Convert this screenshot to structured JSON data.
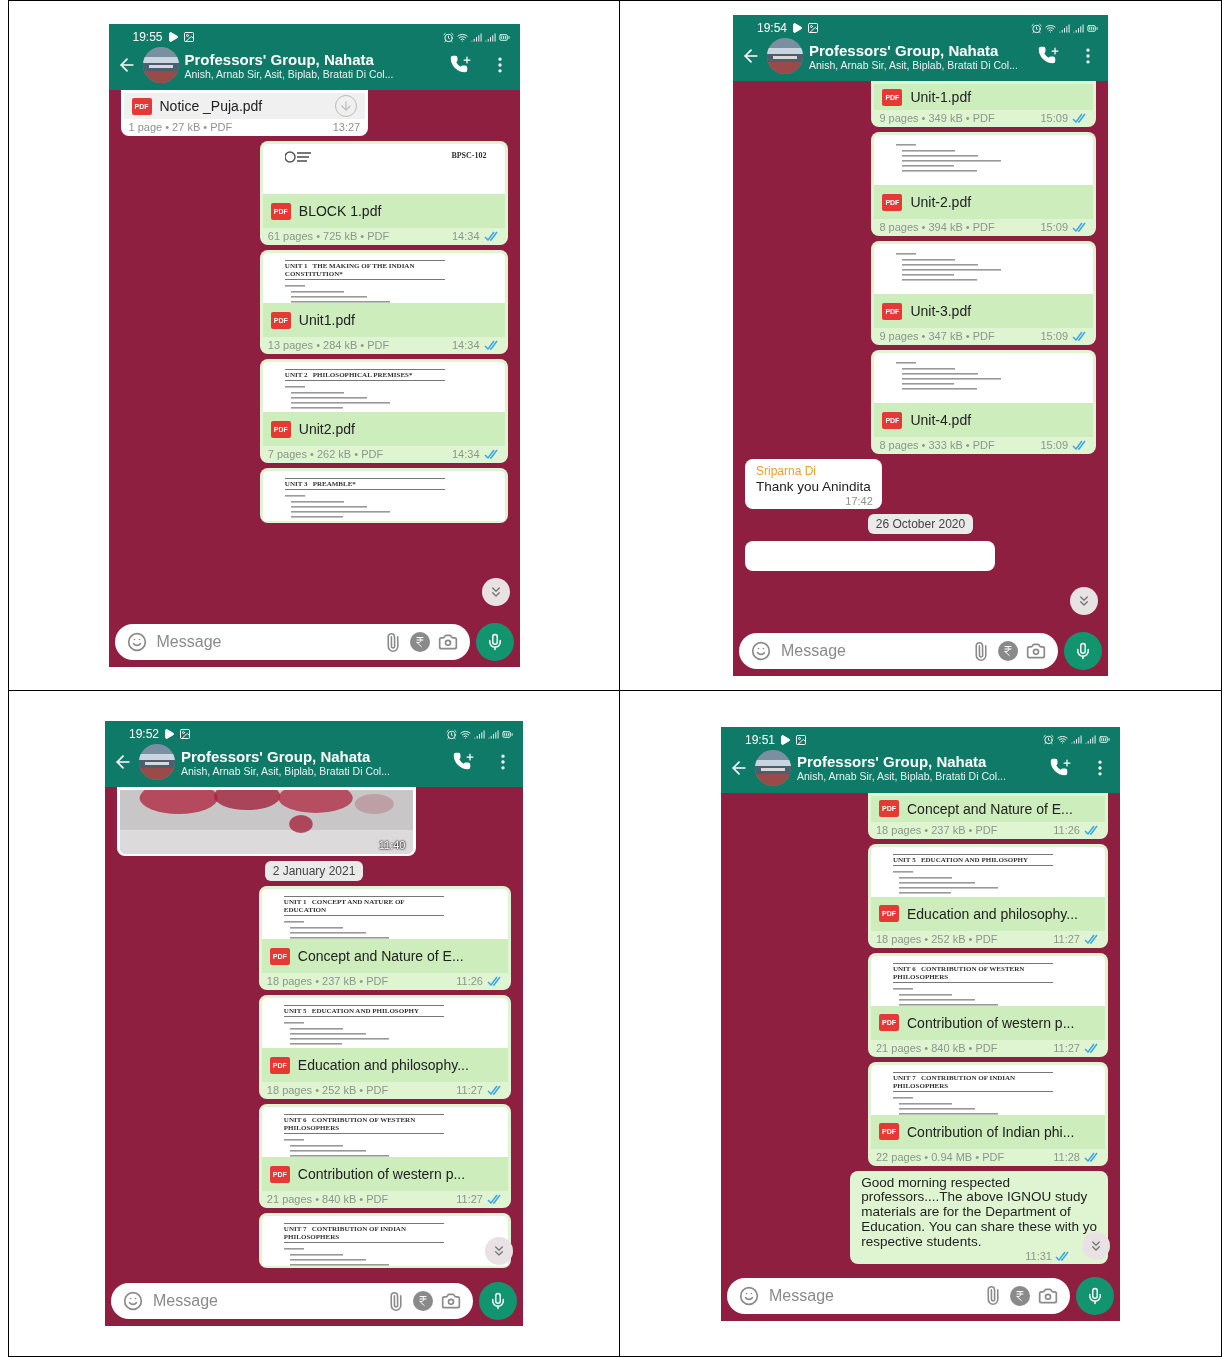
{
  "phones": [
    {
      "status": {
        "time": "19:55"
      },
      "header": {
        "title": "Professors' Group, Nahata",
        "subtitle": "Anish, Arnab Sir, Asit, Biplab, Bratati Di Col..."
      },
      "messages": [
        {
          "kind": "document",
          "outgoing": false,
          "cut_top": true,
          "icon_label": "PDF",
          "name": "Notice _Puja.pdf",
          "download": true,
          "meta": "1 page • 27 kB • PDF",
          "time": "13:27"
        },
        {
          "kind": "document",
          "outgoing": true,
          "preview": {
            "kind": "cover",
            "code": "BPSC-102"
          },
          "icon_label": "PDF",
          "name": "BLOCK 1.pdf",
          "meta": "61 pages • 725 kB • PDF",
          "time": "14:34",
          "read": true
        },
        {
          "kind": "document",
          "outgoing": true,
          "preview": {
            "kind": "unit",
            "heading": "UNIT 1   THE MAKING OF THE INDIAN CONSTITUTION*"
          },
          "icon_label": "PDF",
          "name": "Unit1.pdf",
          "meta": "13 pages • 284 kB • PDF",
          "time": "14:34",
          "read": true
        },
        {
          "kind": "document",
          "outgoing": true,
          "preview": {
            "kind": "unit",
            "heading": "UNIT 2   PHILOSOPHICAL PREMISES*"
          },
          "icon_label": "PDF",
          "name": "Unit2.pdf",
          "meta": "7 pages • 262 kB • PDF",
          "time": "14:34",
          "read": true
        },
        {
          "kind": "document",
          "outgoing": true,
          "preview": {
            "kind": "unit",
            "heading": "UNIT 3   PREAMBLE*"
          }
        }
      ],
      "composer": {
        "placeholder": "Message"
      }
    },
    {
      "status": {
        "time": "19:54"
      },
      "header": {
        "title": "Professors' Group, Nahata",
        "subtitle": "Anish, Arnab Sir, Asit, Biplab, Bratati Di Col..."
      },
      "messages": [
        {
          "kind": "document",
          "outgoing": true,
          "cut_top": true,
          "icon_label": "PDF",
          "name": "Unit-1.pdf",
          "meta": "9 pages • 349 kB • PDF",
          "time": "15:09",
          "read": true
        },
        {
          "kind": "document",
          "outgoing": true,
          "preview": {
            "kind": "unit"
          },
          "icon_label": "PDF",
          "name": "Unit-2.pdf",
          "meta": "8 pages • 394 kB • PDF",
          "time": "15:09",
          "read": true
        },
        {
          "kind": "document",
          "outgoing": true,
          "preview": {
            "kind": "unit"
          },
          "icon_label": "PDF",
          "name": "Unit-3.pdf",
          "meta": "9 pages • 347 kB • PDF",
          "time": "15:09",
          "read": true
        },
        {
          "kind": "document",
          "outgoing": true,
          "preview": {
            "kind": "unit"
          },
          "icon_label": "PDF",
          "name": "Unit-4.pdf",
          "meta": "8 pages • 333 kB • PDF",
          "time": "15:09",
          "read": true
        },
        {
          "kind": "text",
          "outgoing": false,
          "sender": "Sriparna Di",
          "color": "#e8a030",
          "lines": [
            "Thank you Anindita"
          ],
          "time": "17:42"
        },
        {
          "kind": "date",
          "label": "26 October 2020"
        },
        {
          "kind": "cut_bubble"
        }
      ],
      "composer": {
        "placeholder": "Message"
      }
    },
    {
      "status": {
        "time": "19:52"
      },
      "header": {
        "title": "Professors' Group, Nahata",
        "subtitle": "Anish, Arnab Sir, Asit, Biplab, Bratati Di Col..."
      },
      "messages": [
        {
          "outgoing": false,
          "time": "11:40"
        },
        {
          "kind": "date",
          "label": "2 January 2021"
        },
        {
          "kind": "document",
          "outgoing": true,
          "preview": {
            "kind": "unit",
            "heading": "UNIT 1   CONCEPT AND NATURE OF EDUCATION"
          },
          "icon_label": "PDF",
          "name": "Concept and Nature of E...",
          "meta": "18 pages • 237 kB • PDF",
          "time": "11:26",
          "read": true
        },
        {
          "kind": "document",
          "outgoing": true,
          "preview": {
            "kind": "unit",
            "heading": "UNIT 5   EDUCATION AND PHILOSOPHY"
          },
          "icon_label": "PDF",
          "name": "Education and philosophy...",
          "meta": "18 pages • 252 kB • PDF",
          "time": "11:27",
          "read": true
        },
        {
          "kind": "document",
          "outgoing": true,
          "preview": {
            "kind": "unit",
            "heading": "UNIT 6   CONTRIBUTION OF WESTERN PHILOSOPHERS"
          },
          "icon_label": "PDF",
          "name": "Contribution of western p...",
          "meta": "21 pages • 840 kB • PDF",
          "time": "11:27",
          "read": true
        },
        {
          "kind": "document",
          "outgoing": true,
          "preview": {
            "kind": "unit",
            "heading": "UNIT 7   CONTRIBUTION OF INDIAN PHILOSOPHERS"
          }
        }
      ],
      "composer": {
        "placeholder": "Message"
      }
    },
    {
      "status": {
        "time": "19:51"
      },
      "header": {
        "title": "Professors' Group, Nahata",
        "subtitle": "Anish, Arnab Sir, Asit, Biplab, Bratati Di Col..."
      },
      "messages": [
        {
          "kind": "document",
          "outgoing": true,
          "cut_top": true,
          "icon_label": "PDF",
          "name": "Concept and Nature of E...",
          "meta": "18 pages • 237 kB • PDF",
          "time": "11:26",
          "read": true
        },
        {
          "kind": "document",
          "outgoing": true,
          "preview": {
            "kind": "unit",
            "heading": "UNIT 5   EDUCATION AND PHILOSOPHY"
          },
          "icon_label": "PDF",
          "name": "Education and philosophy...",
          "meta": "18 pages • 252 kB • PDF",
          "time": "11:27",
          "read": true
        },
        {
          "kind": "document",
          "outgoing": true,
          "preview": {
            "kind": "unit",
            "heading": "UNIT 6   CONTRIBUTION OF WESTERN PHILOSOPHERS"
          },
          "icon_label": "PDF",
          "name": "Contribution of western p...",
          "meta": "21 pages • 840 kB • PDF",
          "time": "11:27",
          "read": true
        },
        {
          "kind": "document",
          "outgoing": true,
          "preview": {
            "kind": "unit",
            "heading": "UNIT 7   CONTRIBUTION OF INDIAN PHILOSOPHERS"
          },
          "icon_label": "PDF",
          "name": "Contribution of Indian phi...",
          "meta": "22 pages • 0.94 MB • PDF",
          "time": "11:28",
          "read": true
        },
        {
          "kind": "text",
          "outgoing": true,
          "lines": [
            "Good morning respected",
            "professors....The above IGNOU study",
            "materials are for the Department of",
            "Education. You can share these with yo",
            "respective students."
          ],
          "time": "11:31",
          "read": true
        }
      ],
      "composer": {
        "placeholder": "Message"
      }
    }
  ]
}
